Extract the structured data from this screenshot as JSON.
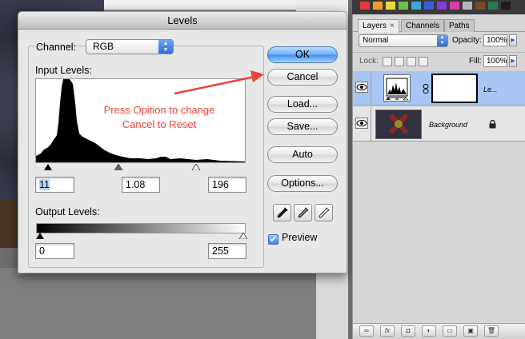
{
  "dialog": {
    "title": "Levels",
    "channel_label": "Channel:",
    "channel_value": "RGB",
    "input_levels_label": "Input Levels:",
    "input_black": "11",
    "input_gamma": "1.08",
    "input_white": "196",
    "output_levels_label": "Output Levels:",
    "output_black": "0",
    "output_white": "255",
    "buttons": {
      "ok": "OK",
      "cancel": "Cancel",
      "load": "Load...",
      "save": "Save...",
      "auto": "Auto",
      "options": "Options..."
    },
    "preview_label": "Preview",
    "preview_checked": true,
    "annotation": "Press Opition to change Cancel to Reset",
    "annotation_color": "#e8443a"
  },
  "layers_panel": {
    "tabs": [
      {
        "label": "Layers",
        "active": true
      },
      {
        "label": "Channels",
        "active": false
      },
      {
        "label": "Paths",
        "active": false
      }
    ],
    "blend_mode": "Normal",
    "opacity_label": "Opacity:",
    "opacity_value": "100%",
    "lock_label": "Lock:",
    "fill_label": "Fill:",
    "fill_value": "100%",
    "layers": [
      {
        "name": "Le...",
        "type": "adjustment-levels",
        "selected": true
      },
      {
        "name": "Background",
        "type": "image",
        "selected": false,
        "locked": true
      }
    ],
    "footer_icons": [
      "link-icon",
      "fx-icon",
      "mask-icon",
      "adjustment-icon",
      "folder-icon",
      "new-layer-icon",
      "trash-icon"
    ],
    "footer_glyphs": {
      "fx": "fx"
    }
  },
  "icons": {
    "close_tab": "×",
    "stepper_up": "▲",
    "stepper_down": "▼",
    "arrow_right": "▶",
    "checkmark": "✔"
  }
}
